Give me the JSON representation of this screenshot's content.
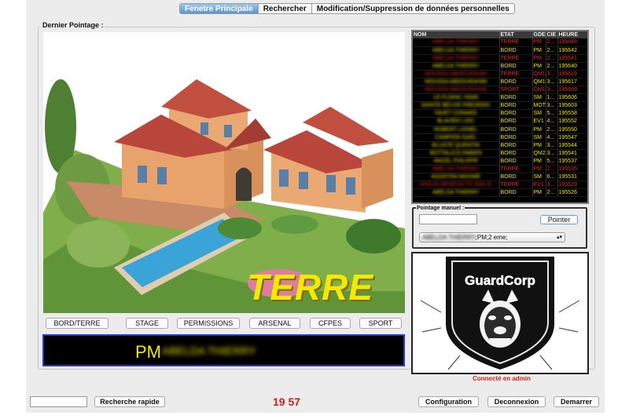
{
  "tabs": [
    {
      "label": "Fenetre Principale",
      "active": true
    },
    {
      "label": "Rechercher",
      "active": false
    },
    {
      "label": "Modification/Suppression de données personnelles",
      "active": false
    }
  ],
  "last_check": {
    "title": "Dernier Pointage :",
    "zone_label": "TERRE",
    "grade": "PM",
    "name": "ABELDA THIERRY"
  },
  "zone_buttons": [
    "BORD/TERRE",
    "STAGE",
    "PERMISSIONS",
    "ARSENAL",
    "CFPES",
    "SPORT"
  ],
  "table": {
    "columns": [
      "NOM",
      "ETAT",
      "GDE",
      "CIE",
      "HEURE"
    ],
    "rows": [
      {
        "nom": "ABELDA THIERRY",
        "etat": "TERRE",
        "gde": "PM",
        "cie": "2...",
        "heure": "195648",
        "color": "#e52626"
      },
      {
        "nom": "ABELDA THIERRY",
        "etat": "BORD",
        "gde": "PM",
        "cie": "2...",
        "heure": "195642",
        "color": "#f1e500"
      },
      {
        "nom": "ABELDA THIERRY",
        "etat": "TERRE",
        "gde": "PM",
        "cie": "2...",
        "heure": "195641",
        "color": "#e52626"
      },
      {
        "nom": "ABELDA THIERRY",
        "etat": "BORD",
        "gde": "PM",
        "cie": "2...",
        "heure": "195640",
        "color": "#f1e500"
      },
      {
        "nom": "MOUSSA ABDOURAHIM",
        "etat": "TERRE",
        "gde": "QM1",
        "cie": "3...",
        "heure": "195619",
        "color": "#e52626"
      },
      {
        "nom": "MOUSSA ABDOURAHIM",
        "etat": "BORD",
        "gde": "QM1",
        "cie": "3...",
        "heure": "195617",
        "color": "#f1e500"
      },
      {
        "nom": "MOUSSA ABDOURAHIM",
        "etat": "SPORT",
        "gde": "QM1",
        "cie": "3...",
        "heure": "195609",
        "color": "#e52626"
      },
      {
        "nom": "LE FLOHIC YANN",
        "etat": "BORD",
        "gde": "SM",
        "cie": "1...",
        "heure": "195606",
        "color": "#f1e500"
      },
      {
        "nom": "SAINTE BEUVE FREDERIC",
        "etat": "BORD",
        "gde": "MOT",
        "cie": "3...",
        "heure": "195603",
        "color": "#f1e500"
      },
      {
        "nom": "FAVET CONARD",
        "etat": "BORD",
        "gde": "SM",
        "cie": "5...",
        "heure": "195558",
        "color": "#f1e500"
      },
      {
        "nom": "BLAVIER LOIC",
        "etat": "BORD",
        "gde": "EV1",
        "cie": "4...",
        "heure": "195552",
        "color": "#f1e500"
      },
      {
        "nom": "ROBERT LIONEL",
        "etat": "BORD",
        "gde": "PM",
        "cie": "2...",
        "heure": "195550",
        "color": "#f1e500"
      },
      {
        "nom": "CAMPION GAEL",
        "etat": "BORD",
        "gde": "SM",
        "cie": "4...",
        "heure": "195547",
        "color": "#f1e500"
      },
      {
        "nom": "BLUSTE QUENTIN",
        "etat": "BORD",
        "gde": "PM",
        "cie": "3...",
        "heure": "195544",
        "color": "#f1e500"
      },
      {
        "nom": "BOTTALICO FABIEN",
        "etat": "BORD",
        "gde": "QM2",
        "cie": "3...",
        "heure": "195541",
        "color": "#f1e500"
      },
      {
        "nom": "ANCEL PHILIPPE",
        "etat": "BORD",
        "gde": "PM",
        "cie": "5...",
        "heure": "195537",
        "color": "#f1e500"
      },
      {
        "nom": "ABELDA THIERRY",
        "etat": "TERRE",
        "gde": "PM",
        "cie": "2...",
        "heure": "195535",
        "color": "#e52626"
      },
      {
        "nom": "AGOSTINI MAXIME",
        "etat": "BORD",
        "gde": "SM",
        "cie": "6...",
        "heure": "195531",
        "color": "#f1e500"
      },
      {
        "nom": "AROUD BENEDICTE EMILIE",
        "etat": "TERRE",
        "gde": "EV1",
        "cie": "3...",
        "heure": "195529",
        "color": "#e52626"
      },
      {
        "nom": "ABELDA THIERRY",
        "etat": "BORD",
        "gde": "PM",
        "cie": "2...",
        "heure": "195526",
        "color": "#f1e500"
      }
    ]
  },
  "manual": {
    "title": "Pointage manuel :",
    "input_value": "",
    "button_label": "Pointer",
    "select_name": "ABELDA THIERRY",
    "select_rest": ";PM;2 eme;"
  },
  "logo": {
    "brand": "GuardCorp"
  },
  "status": {
    "connected": "Connecté en admin"
  },
  "bottom": {
    "quick_search_value": "",
    "quick_search_label": "Recherche rapide",
    "clock": "19 57",
    "config_label": "Configuration",
    "logout_label": "Deconnexion",
    "start_label": "Demarrer"
  },
  "colors": {
    "red": "#d21d1d",
    "yellow": "#f1e500",
    "accent_blue": "#2737d6"
  }
}
